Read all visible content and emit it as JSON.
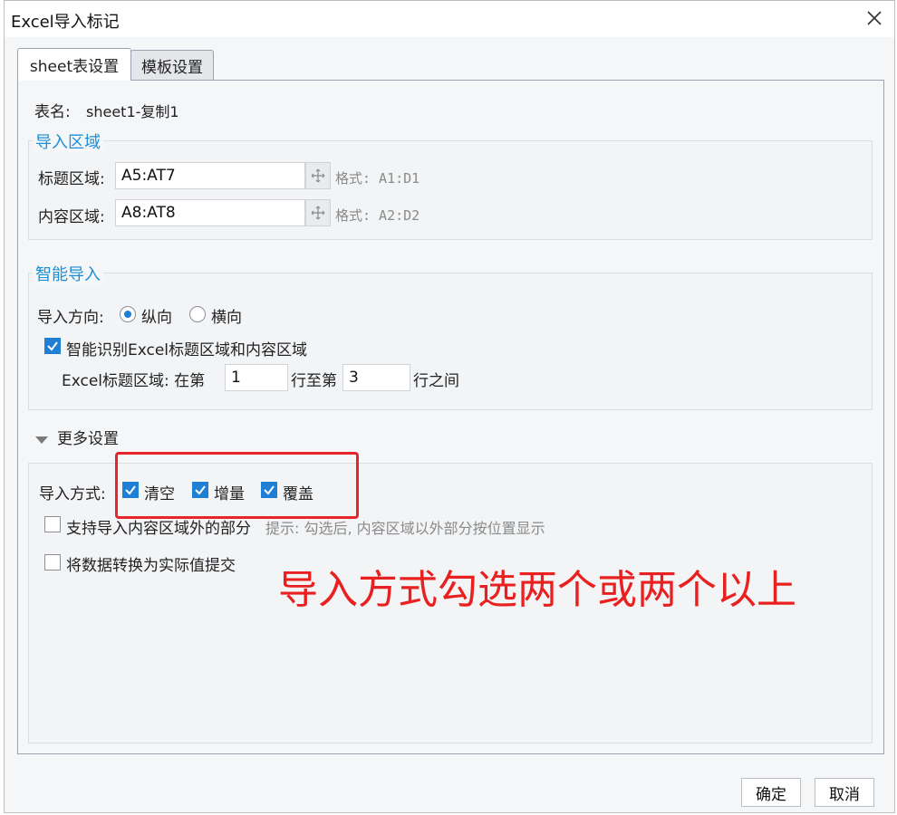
{
  "dialog": {
    "title": "Excel导入标记",
    "tabs": [
      {
        "label": "sheet表设置",
        "active": true
      },
      {
        "label": "模板设置",
        "active": false
      }
    ]
  },
  "sheet": {
    "label": "表名:",
    "value": "sheet1-复制1"
  },
  "import_area": {
    "legend": "导入区域",
    "title_area": {
      "label": "标题区域:",
      "value": "A5:AT7",
      "format_hint": "格式: A1:D1"
    },
    "content_area": {
      "label": "内容区域:",
      "value": "A8:AT8",
      "format_hint": "格式: A2:D2"
    }
  },
  "smart_import": {
    "legend": "智能导入",
    "direction_label": "导入方向:",
    "direction_options": [
      {
        "label": "纵向",
        "selected": true
      },
      {
        "label": "横向",
        "selected": false
      }
    ],
    "auto_detect": {
      "label": "智能识别Excel标题区域和内容区域",
      "checked": true
    },
    "header_range": {
      "label": "Excel标题区域: 在第",
      "from": "1",
      "middle": "行至第",
      "to": "3",
      "suffix": "行之间"
    }
  },
  "more_settings": {
    "label": "更多设置",
    "mode_label": "导入方式:",
    "modes": [
      {
        "label": "清空",
        "checked": true
      },
      {
        "label": "增量",
        "checked": true
      },
      {
        "label": "覆盖",
        "checked": true
      }
    ],
    "outside_area": {
      "label": "支持导入内容区域外的部分",
      "checked": false,
      "hint": "提示: 勾选后, 内容区域以外部分按位置显示"
    },
    "convert_actual": {
      "label": "将数据转换为实际值提交",
      "checked": false
    }
  },
  "annotation": "导入方式勾选两个或两个以上",
  "buttons": {
    "ok": "确定",
    "cancel": "取消"
  },
  "colors": {
    "accent": "#1a8fd6",
    "checkbox": "#1f7fd4",
    "annotation": "#e8201f"
  },
  "icons": {
    "close": "close-icon",
    "picker": "move-arrows-icon",
    "collapse": "triangle-down-icon"
  }
}
